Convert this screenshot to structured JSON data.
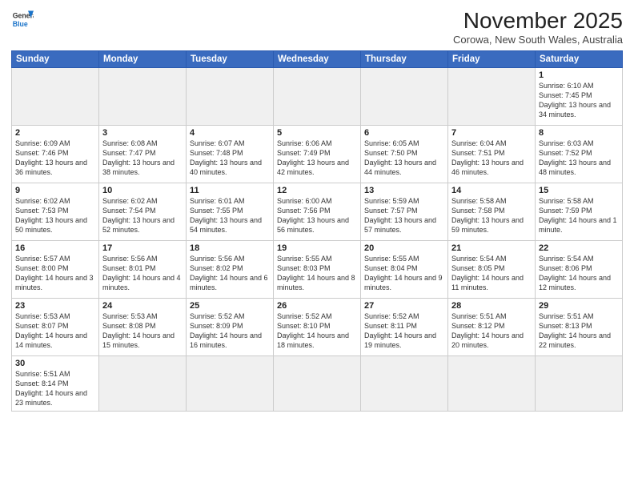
{
  "logo": {
    "line1": "General",
    "line2": "Blue"
  },
  "title": "November 2025",
  "location": "Corowa, New South Wales, Australia",
  "days_of_week": [
    "Sunday",
    "Monday",
    "Tuesday",
    "Wednesday",
    "Thursday",
    "Friday",
    "Saturday"
  ],
  "weeks": [
    [
      {
        "day": "",
        "info": ""
      },
      {
        "day": "",
        "info": ""
      },
      {
        "day": "",
        "info": ""
      },
      {
        "day": "",
        "info": ""
      },
      {
        "day": "",
        "info": ""
      },
      {
        "day": "",
        "info": ""
      },
      {
        "day": "1",
        "info": "Sunrise: 6:10 AM\nSunset: 7:45 PM\nDaylight: 13 hours\nand 34 minutes."
      }
    ],
    [
      {
        "day": "2",
        "info": "Sunrise: 6:09 AM\nSunset: 7:46 PM\nDaylight: 13 hours\nand 36 minutes."
      },
      {
        "day": "3",
        "info": "Sunrise: 6:08 AM\nSunset: 7:47 PM\nDaylight: 13 hours\nand 38 minutes."
      },
      {
        "day": "4",
        "info": "Sunrise: 6:07 AM\nSunset: 7:48 PM\nDaylight: 13 hours\nand 40 minutes."
      },
      {
        "day": "5",
        "info": "Sunrise: 6:06 AM\nSunset: 7:49 PM\nDaylight: 13 hours\nand 42 minutes."
      },
      {
        "day": "6",
        "info": "Sunrise: 6:05 AM\nSunset: 7:50 PM\nDaylight: 13 hours\nand 44 minutes."
      },
      {
        "day": "7",
        "info": "Sunrise: 6:04 AM\nSunset: 7:51 PM\nDaylight: 13 hours\nand 46 minutes."
      },
      {
        "day": "8",
        "info": "Sunrise: 6:03 AM\nSunset: 7:52 PM\nDaylight: 13 hours\nand 48 minutes."
      }
    ],
    [
      {
        "day": "9",
        "info": "Sunrise: 6:02 AM\nSunset: 7:53 PM\nDaylight: 13 hours\nand 50 minutes."
      },
      {
        "day": "10",
        "info": "Sunrise: 6:02 AM\nSunset: 7:54 PM\nDaylight: 13 hours\nand 52 minutes."
      },
      {
        "day": "11",
        "info": "Sunrise: 6:01 AM\nSunset: 7:55 PM\nDaylight: 13 hours\nand 54 minutes."
      },
      {
        "day": "12",
        "info": "Sunrise: 6:00 AM\nSunset: 7:56 PM\nDaylight: 13 hours\nand 56 minutes."
      },
      {
        "day": "13",
        "info": "Sunrise: 5:59 AM\nSunset: 7:57 PM\nDaylight: 13 hours\nand 57 minutes."
      },
      {
        "day": "14",
        "info": "Sunrise: 5:58 AM\nSunset: 7:58 PM\nDaylight: 13 hours\nand 59 minutes."
      },
      {
        "day": "15",
        "info": "Sunrise: 5:58 AM\nSunset: 7:59 PM\nDaylight: 14 hours\nand 1 minute."
      }
    ],
    [
      {
        "day": "16",
        "info": "Sunrise: 5:57 AM\nSunset: 8:00 PM\nDaylight: 14 hours\nand 3 minutes."
      },
      {
        "day": "17",
        "info": "Sunrise: 5:56 AM\nSunset: 8:01 PM\nDaylight: 14 hours\nand 4 minutes."
      },
      {
        "day": "18",
        "info": "Sunrise: 5:56 AM\nSunset: 8:02 PM\nDaylight: 14 hours\nand 6 minutes."
      },
      {
        "day": "19",
        "info": "Sunrise: 5:55 AM\nSunset: 8:03 PM\nDaylight: 14 hours\nand 8 minutes."
      },
      {
        "day": "20",
        "info": "Sunrise: 5:55 AM\nSunset: 8:04 PM\nDaylight: 14 hours\nand 9 minutes."
      },
      {
        "day": "21",
        "info": "Sunrise: 5:54 AM\nSunset: 8:05 PM\nDaylight: 14 hours\nand 11 minutes."
      },
      {
        "day": "22",
        "info": "Sunrise: 5:54 AM\nSunset: 8:06 PM\nDaylight: 14 hours\nand 12 minutes."
      }
    ],
    [
      {
        "day": "23",
        "info": "Sunrise: 5:53 AM\nSunset: 8:07 PM\nDaylight: 14 hours\nand 14 minutes."
      },
      {
        "day": "24",
        "info": "Sunrise: 5:53 AM\nSunset: 8:08 PM\nDaylight: 14 hours\nand 15 minutes."
      },
      {
        "day": "25",
        "info": "Sunrise: 5:52 AM\nSunset: 8:09 PM\nDaylight: 14 hours\nand 16 minutes."
      },
      {
        "day": "26",
        "info": "Sunrise: 5:52 AM\nSunset: 8:10 PM\nDaylight: 14 hours\nand 18 minutes."
      },
      {
        "day": "27",
        "info": "Sunrise: 5:52 AM\nSunset: 8:11 PM\nDaylight: 14 hours\nand 19 minutes."
      },
      {
        "day": "28",
        "info": "Sunrise: 5:51 AM\nSunset: 8:12 PM\nDaylight: 14 hours\nand 20 minutes."
      },
      {
        "day": "29",
        "info": "Sunrise: 5:51 AM\nSunset: 8:13 PM\nDaylight: 14 hours\nand 22 minutes."
      }
    ],
    [
      {
        "day": "30",
        "info": "Sunrise: 5:51 AM\nSunset: 8:14 PM\nDaylight: 14 hours\nand 23 minutes."
      },
      {
        "day": "",
        "info": ""
      },
      {
        "day": "",
        "info": ""
      },
      {
        "day": "",
        "info": ""
      },
      {
        "day": "",
        "info": ""
      },
      {
        "day": "",
        "info": ""
      },
      {
        "day": "",
        "info": ""
      }
    ]
  ]
}
